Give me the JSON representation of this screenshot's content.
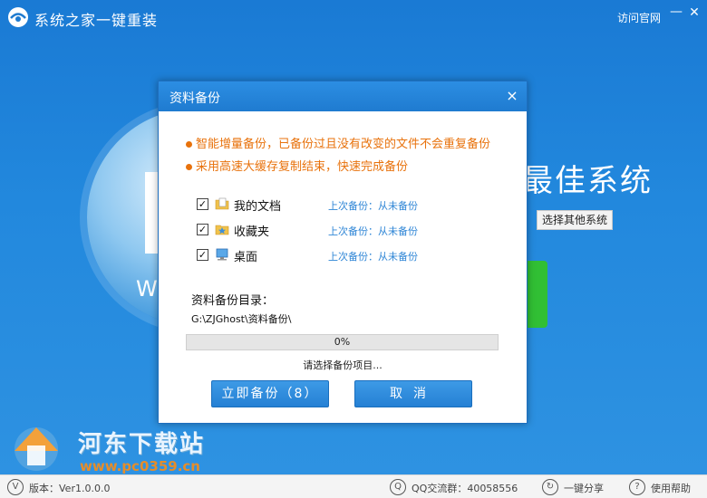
{
  "app": {
    "title": "系统之家一键重装",
    "visit_site": "访问官网",
    "min_symbol": "—",
    "close_symbol": "✕",
    "bg_heading": "最佳系统",
    "bg_disc_letter": "W",
    "choose_other": "选择其他系统"
  },
  "watermark": {
    "text": "河东下载站",
    "url": "www.pc0359.cn"
  },
  "statusbar": {
    "version": "版本：Ver1.0.0.0",
    "qq_group": "QQ交流群：40058556",
    "share": "一键分享",
    "help": "使用帮助"
  },
  "dialog": {
    "title": "资料备份",
    "close_symbol": "×",
    "notes": [
      "智能增量备份，已备份过且没有改变的文件不会重复备份",
      "采用高速大缓存复制结束，快速完成备份"
    ],
    "items": [
      {
        "label": "我的文档",
        "status": "上次备份：从未备份",
        "checked": "✓",
        "icon": "documents-folder-icon"
      },
      {
        "label": "收藏夹",
        "status": "上次备份：从未备份",
        "checked": "✓",
        "icon": "favorites-folder-icon"
      },
      {
        "label": "桌面",
        "status": "上次备份：从未备份",
        "checked": "✓",
        "icon": "desktop-icon"
      }
    ],
    "dir_label": "资料备份目录：",
    "dir_path": "G:\\ZJGhost\\资料备份\\",
    "progress": {
      "value": 0,
      "text": "0%"
    },
    "progress_status": "请选择备份项目...",
    "backup_button": "立即备份（8）",
    "cancel_button": "取消"
  },
  "colors": {
    "accent": "#1f7bd0",
    "note": "#e8720c",
    "status_link": "#2f86d6",
    "green": "#31bf34"
  }
}
